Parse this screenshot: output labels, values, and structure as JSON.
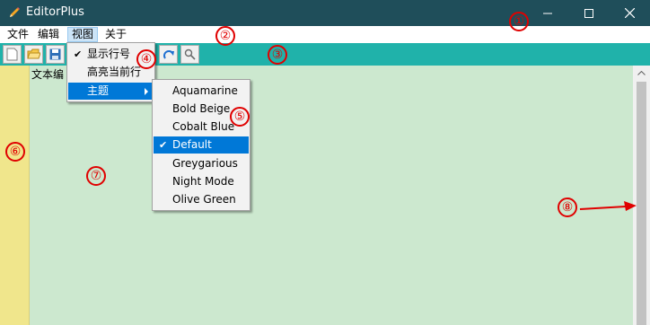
{
  "window": {
    "title": "EditorPlus",
    "controls": [
      "minimize-icon",
      "maximize-icon",
      "close-icon"
    ]
  },
  "menubar": {
    "items": [
      {
        "label": "文件"
      },
      {
        "label": "编辑"
      },
      {
        "label": "视图",
        "active": true
      },
      {
        "label": "关于"
      }
    ]
  },
  "toolbar": {
    "background": "#20b2aa",
    "buttons": [
      "new-file-icon",
      "open-folder-icon",
      "save-icon",
      "redo-icon",
      "search-icon"
    ]
  },
  "view_menu": {
    "items": [
      {
        "label": "显示行号",
        "checked": true
      },
      {
        "label": "高亮当前行",
        "checked": false
      },
      {
        "label": "主题",
        "has_submenu": true,
        "highlighted": true
      }
    ]
  },
  "theme_menu": {
    "items": [
      {
        "label": "Aquamarine"
      },
      {
        "label": "Bold Beige"
      },
      {
        "label": "Cobalt Blue"
      },
      {
        "label": "Default",
        "checked": true,
        "highlighted": true
      },
      {
        "label": "Greygarious"
      },
      {
        "label": "Night Mode"
      },
      {
        "label": "Olive Green"
      }
    ]
  },
  "editor": {
    "visible_text": "文本编",
    "background": "#cce8cf",
    "gutter_background": "#f0e68c"
  },
  "annotations": [
    "①",
    "②",
    "③",
    "④",
    "⑤",
    "⑥",
    "⑦",
    "⑧"
  ],
  "colors": {
    "titlebar": "#1f4e5a",
    "highlight": "#0078d7",
    "annotation": "#e00000"
  }
}
